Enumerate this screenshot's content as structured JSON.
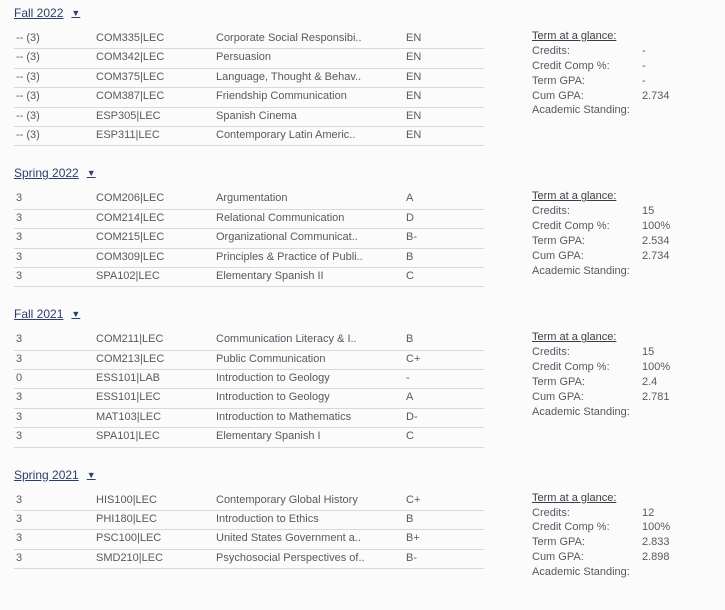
{
  "glance": {
    "title": "Term at a glance:",
    "labels": {
      "credits": "Credits:",
      "credit_comp": "Credit Comp %:",
      "term_gpa": "Term GPA:",
      "cum_gpa": "Cum GPA:",
      "standing": "Academic Standing:"
    }
  },
  "terms": [
    {
      "name": "Fall 2022",
      "summary": {
        "credits": "-",
        "credit_comp": "-",
        "term_gpa": "-",
        "cum_gpa": "2.734",
        "standing": ""
      },
      "courses": [
        {
          "credits": "-- (3)",
          "code": "COM335|LEC",
          "title": "Corporate Social Responsibi..",
          "grade": "EN"
        },
        {
          "credits": "-- (3)",
          "code": "COM342|LEC",
          "title": "Persuasion",
          "grade": "EN"
        },
        {
          "credits": "-- (3)",
          "code": "COM375|LEC",
          "title": "Language, Thought & Behav..",
          "grade": "EN"
        },
        {
          "credits": "-- (3)",
          "code": "COM387|LEC",
          "title": "Friendship Communication",
          "grade": "EN"
        },
        {
          "credits": "-- (3)",
          "code": "ESP305|LEC",
          "title": "Spanish Cinema",
          "grade": "EN"
        },
        {
          "credits": "-- (3)",
          "code": "ESP311|LEC",
          "title": "Contemporary Latin Americ..",
          "grade": "EN"
        }
      ]
    },
    {
      "name": "Spring 2022",
      "summary": {
        "credits": "15",
        "credit_comp": "100%",
        "term_gpa": "2.534",
        "cum_gpa": "2.734",
        "standing": ""
      },
      "courses": [
        {
          "credits": "3",
          "code": "COM206|LEC",
          "title": "Argumentation",
          "grade": "A"
        },
        {
          "credits": "3",
          "code": "COM214|LEC",
          "title": "Relational Communication",
          "grade": "D"
        },
        {
          "credits": "3",
          "code": "COM215|LEC",
          "title": "Organizational Communicat..",
          "grade": "B-"
        },
        {
          "credits": "3",
          "code": "COM309|LEC",
          "title": "Principles & Practice of Publi..",
          "grade": "B"
        },
        {
          "credits": "3",
          "code": "SPA102|LEC",
          "title": "Elementary Spanish II",
          "grade": "C"
        }
      ]
    },
    {
      "name": "Fall 2021",
      "summary": {
        "credits": "15",
        "credit_comp": "100%",
        "term_gpa": "2.4",
        "cum_gpa": "2.781",
        "standing": ""
      },
      "courses": [
        {
          "credits": "3",
          "code": "COM211|LEC",
          "title": "Communication Literacy & I..",
          "grade": "B"
        },
        {
          "credits": "3",
          "code": "COM213|LEC",
          "title": "Public Communication",
          "grade": "C+"
        },
        {
          "credits": "0",
          "code": "ESS101|LAB",
          "title": "Introduction to Geology",
          "grade": "-"
        },
        {
          "credits": "3",
          "code": "ESS101|LEC",
          "title": "Introduction to Geology",
          "grade": "A"
        },
        {
          "credits": "3",
          "code": "MAT103|LEC",
          "title": "Introduction to Mathematics",
          "grade": "D-"
        },
        {
          "credits": "3",
          "code": "SPA101|LEC",
          "title": "Elementary Spanish I",
          "grade": "C"
        }
      ]
    },
    {
      "name": "Spring 2021",
      "summary": {
        "credits": "12",
        "credit_comp": "100%",
        "term_gpa": "2.833",
        "cum_gpa": "2.898",
        "standing": ""
      },
      "courses": [
        {
          "credits": "3",
          "code": "HIS100|LEC",
          "title": "Contemporary Global History",
          "grade": "C+"
        },
        {
          "credits": "3",
          "code": "PHI180|LEC",
          "title": "Introduction to Ethics",
          "grade": "B"
        },
        {
          "credits": "3",
          "code": "PSC100|LEC",
          "title": "United States Government a..",
          "grade": "B+"
        },
        {
          "credits": "3",
          "code": "SMD210|LEC",
          "title": "Psychosocial Perspectives of..",
          "grade": "B-"
        }
      ]
    }
  ]
}
